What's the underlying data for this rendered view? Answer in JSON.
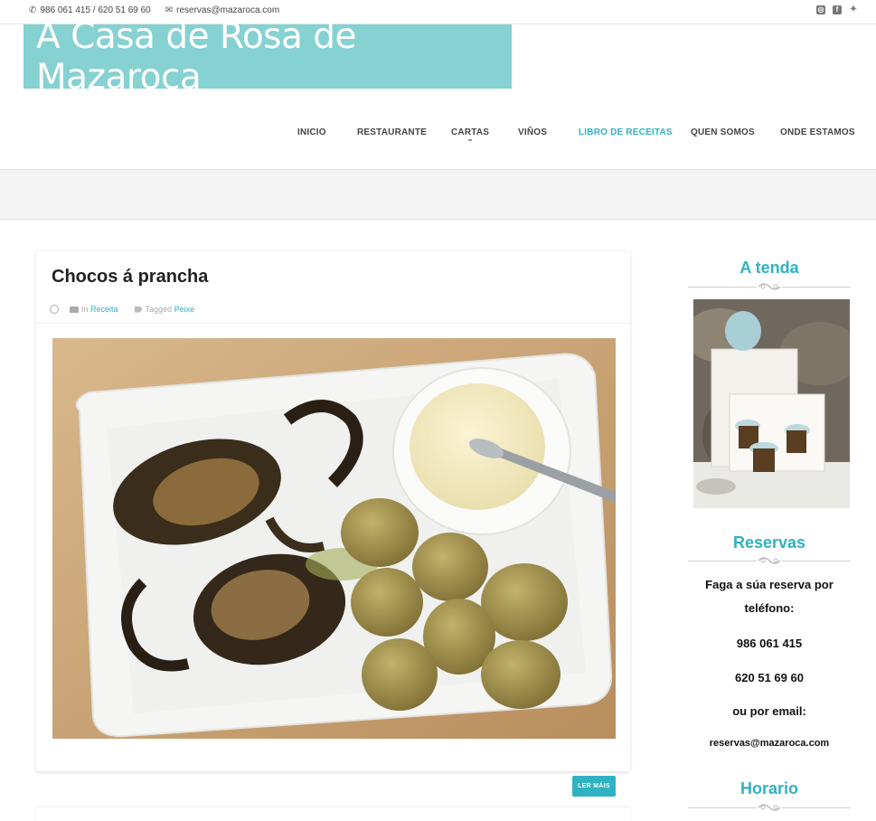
{
  "topbar": {
    "phones": "986 061 415 / 620 51 69 60",
    "email": "reservas@mazaroca.com",
    "social": [
      "instagram-icon",
      "facebook-icon",
      "twitter-icon"
    ]
  },
  "logo": {
    "text": "A Casa de Rosa de Mazaroca"
  },
  "nav": {
    "items": [
      {
        "label": "INICIO"
      },
      {
        "label": "RESTAURANTE"
      },
      {
        "label": "CARTAS"
      },
      {
        "label": "VIÑOS"
      },
      {
        "label": "LIBRO DE RECEITAS"
      },
      {
        "label": "QUEN SOMOS"
      },
      {
        "label": "ONDE ESTAMOS"
      }
    ],
    "active": "LIBRO DE RECEITAS"
  },
  "post": {
    "title": "Chocos á prancha",
    "in_label": "In",
    "category": "Receita",
    "tagged_label": "Tagged",
    "tag": "Peixe",
    "read_more": "LER MÁIS"
  },
  "sidebar": {
    "shop_title": "A tenda",
    "reservas_title": "Reservas",
    "reservas_line1": "Faga a súa reserva por",
    "reservas_line2": "teléfono:",
    "phone1": "986 061 415",
    "phone2": "620 51 69 60",
    "email_label": "ou por email:",
    "email": "reservas@mazaroca.com",
    "horario_title": "Horario"
  },
  "colors": {
    "accent": "#2fb2c2",
    "logo_bg": "#86d1d1"
  }
}
